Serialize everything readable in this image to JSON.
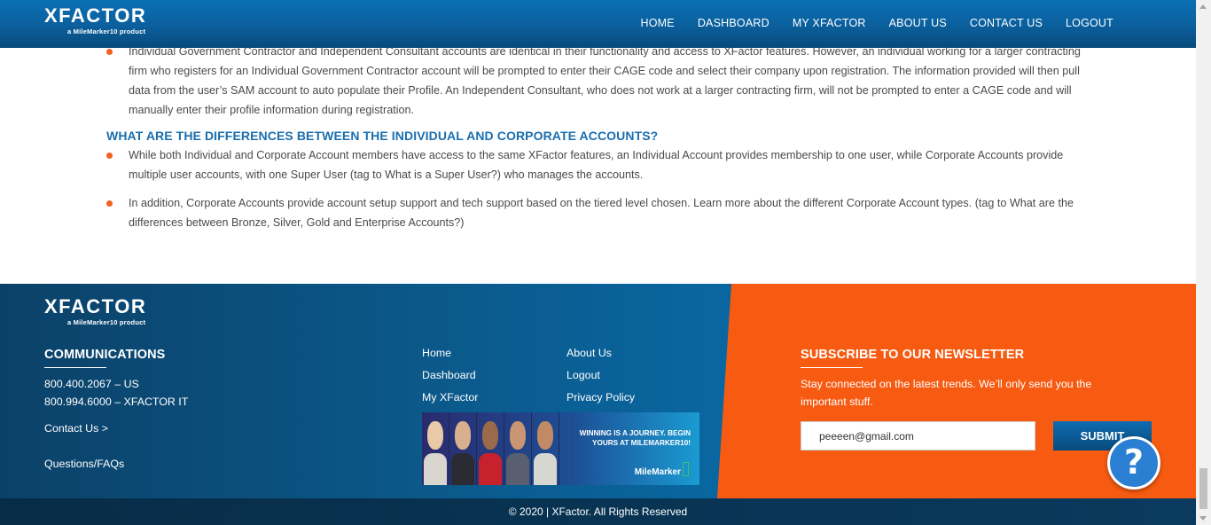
{
  "brand": {
    "logo_word": "XFACTOR",
    "logo_tagline": "a MileMarker10 product"
  },
  "header": {
    "nav": [
      {
        "label": "HOME"
      },
      {
        "label": "DASHBOARD"
      },
      {
        "label": "MY XFACTOR"
      },
      {
        "label": "ABOUT US"
      },
      {
        "label": "CONTACT US"
      },
      {
        "label": "LOGOUT"
      }
    ]
  },
  "main": {
    "list1": [
      "Individual Government Contractor and Independent Consultant accounts are identical in their functionality and access to XFactor features. However, an individual working for a larger contracting firm who registers for an Individual Government Contractor account will be prompted to enter their CAGE code and select their company upon registration. The information provided will then pull data from the user’s SAM account to auto populate their Profile. An Independent Consultant, who does not work at a larger contracting firm, will not be prompted to enter a CAGE code and will manually enter their profile information during registration."
    ],
    "faq_heading": "WHAT ARE THE DIFFERENCES BETWEEN THE INDIVIDUAL AND CORPORATE ACCOUNTS?",
    "list2": [
      "While both Individual and Corporate Account members have access to the same XFactor features, an Individual Account provides membership to one user, while Corporate Accounts provide multiple user accounts, with one Super User (tag to What is a Super User?) who manages the accounts.",
      "In addition, Corporate Accounts provide account setup support and tech support based on the tiered level chosen. Learn more about the different Corporate Account types. (tag to What are the differences between Bronze, Silver, Gold and Enterprise Accounts?)"
    ]
  },
  "footer": {
    "communications": {
      "heading": "COMMUNICATIONS",
      "phone1": "800.400.2067 – US",
      "phone2": "800.994.6000 – XFACTOR IT",
      "contact_link": "Contact Us >",
      "faqs_link": "Questions/FAQs"
    },
    "links": [
      {
        "label": "Home"
      },
      {
        "label": "About Us"
      },
      {
        "label": "Dashboard"
      },
      {
        "label": "Logout"
      },
      {
        "label": "My XFactor"
      },
      {
        "label": "Privacy Policy"
      }
    ],
    "banner": {
      "tagline": "WINNING IS A JOURNEY. BEGIN YOURS AT MILEMARKER10!",
      "brand": "MileMarker"
    },
    "newsletter": {
      "heading": "SUBSCRIBE TO OUR NEWSLETTER",
      "description": "Stay connected on the latest trends. We’ll only send you the important stuff.",
      "email_value": "peeeen@gmail.com",
      "submit_label": "SUBMIT"
    },
    "copyright": "© 2020 | XFactor. All Rights Reserved"
  },
  "help": {
    "label": "?"
  },
  "colors": {
    "header_blue": "#0b5f9c",
    "accent_orange": "#f75b12",
    "heading_blue": "#1a6eaf",
    "bullet_orange": "#f26122"
  }
}
